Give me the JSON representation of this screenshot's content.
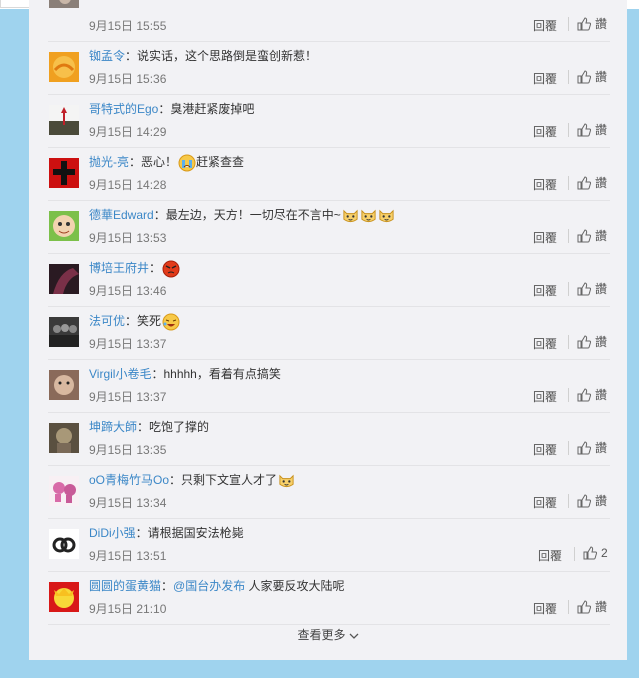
{
  "comments": [
    {
      "user": "",
      "text": "",
      "time": "9月15日 15:55",
      "reply": "回覆",
      "likes": "讚"
    },
    {
      "user": "铷孟令",
      "text": "：说实话，这个思路倒是蛮创新惹！",
      "time": "9月15日 15:36",
      "reply": "回覆",
      "likes": "讚"
    },
    {
      "user": "哥特式的Ego",
      "text": "：臭港赶紧废掉吧",
      "time": "9月15日 14:29",
      "reply": "回覆",
      "likes": "讚"
    },
    {
      "user": "抛光-亮",
      "text": "：恶心！",
      "text2": "赶紧查查",
      "time": "9月15日 14:28",
      "reply": "回覆",
      "likes": "讚",
      "emoji": "crying-face-icon"
    },
    {
      "user": "德華Edward",
      "text": "：最左边，天方！一切尽在不言中~",
      "time": "9月15日 13:53",
      "reply": "回覆",
      "likes": "讚",
      "emoji": "cat-face-icon"
    },
    {
      "user": "博培王府井",
      "text": "：",
      "time": "9月15日 13:46",
      "reply": "回覆",
      "likes": "讚",
      "emoji": "angry-face-icon"
    },
    {
      "user": "法可优",
      "text": "：笑死",
      "time": "9月15日 13:37",
      "reply": "回覆",
      "likes": "讚",
      "emoji": "laughing-face-icon"
    },
    {
      "user": "Virgil小卷毛",
      "text": "：hhhhh，看着有点搞笑",
      "time": "9月15日 13:37",
      "reply": "回覆",
      "likes": "讚"
    },
    {
      "user": "坤蹄大師",
      "text": "：吃饱了撑的",
      "time": "9月15日 13:35",
      "reply": "回覆",
      "likes": "讚"
    },
    {
      "user": "oO青梅竹马Oo",
      "text": "：只剩下文宣人才了",
      "time": "9月15日 13:34",
      "reply": "回覆",
      "likes": "讚",
      "emoji": "cat-face-icon"
    },
    {
      "user": "DiDi小强",
      "text": "：请根据国安法枪毙",
      "time": "9月15日 13:51",
      "reply": "回覆",
      "likes": "2"
    },
    {
      "user": "圆圆的蛋黄猫",
      "text": "：",
      "mention": "@国台办发布",
      "text2": " 人家要反攻大陆呢",
      "time": "9月15日 21:10",
      "reply": "回覆",
      "likes": "讚"
    }
  ],
  "more_label": "查看更多",
  "colors": {
    "page_bg": "#9fd3ee",
    "panel_bg": "#f2f2f5",
    "link": "#3b87c7"
  }
}
